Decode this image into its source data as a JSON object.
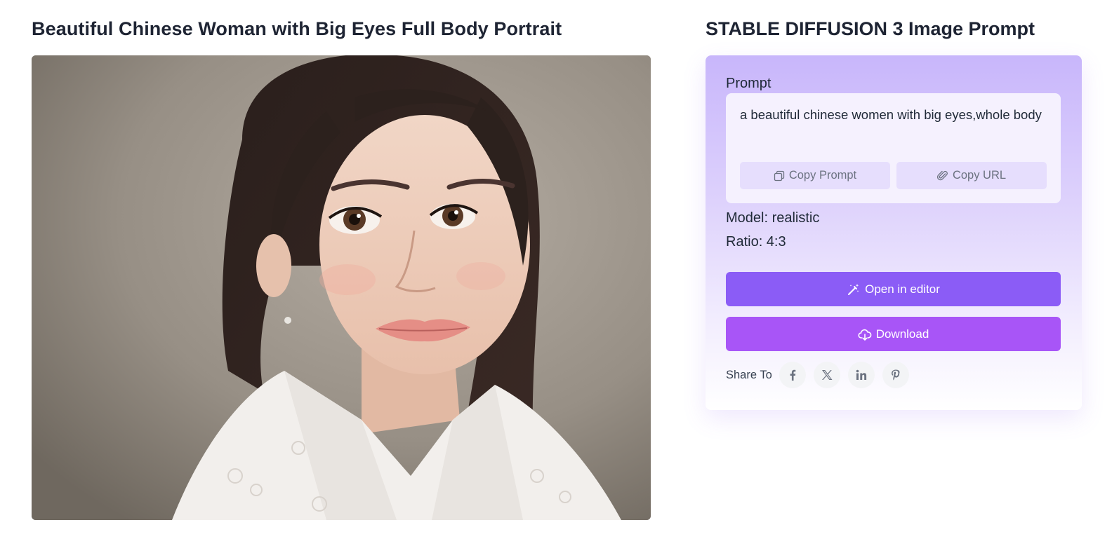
{
  "image_title": "Beautiful Chinese Woman with Big Eyes Full Body Portrait",
  "panel": {
    "title": "STABLE DIFFUSION 3 Image Prompt",
    "prompt_label": "Prompt",
    "prompt_text": "a beautiful chinese women with big eyes,whole body",
    "copy_prompt_label": "Copy Prompt",
    "copy_url_label": "Copy URL",
    "model_text": "Model: realistic",
    "ratio_text": "Ratio: 4:3",
    "open_editor_label": "Open in editor",
    "download_label": "Download",
    "share_label": "Share To"
  },
  "share_icons": [
    "facebook-icon",
    "x-icon",
    "linkedin-icon",
    "pinterest-icon"
  ],
  "colors": {
    "accent_primary": "#8b5cf6",
    "accent_secondary": "#a855f7",
    "card_gradient_top": "#c8b6fb"
  }
}
